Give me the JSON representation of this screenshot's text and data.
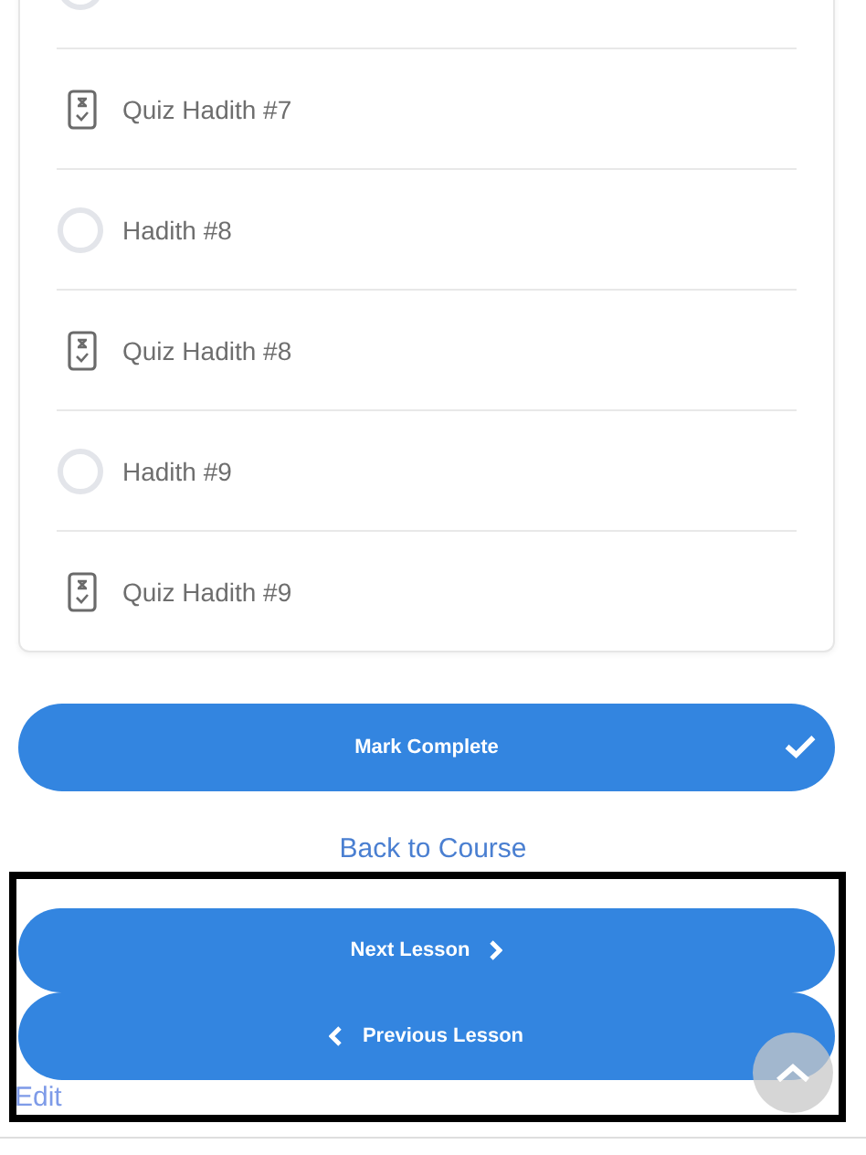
{
  "lessons": [
    {
      "kind": "lesson"
    },
    {
      "kind": "quiz",
      "label": "Quiz Hadith #7"
    },
    {
      "kind": "lesson",
      "label": "Hadith #8"
    },
    {
      "kind": "quiz",
      "label": "Quiz Hadith #8"
    },
    {
      "kind": "lesson",
      "label": "Hadith #9"
    },
    {
      "kind": "quiz",
      "label": "Quiz Hadith #9"
    }
  ],
  "mark_complete": {
    "label": "Mark Complete"
  },
  "back_link": "Back to Course",
  "navigation": {
    "next": "Next Lesson",
    "previous": "Previous Lesson"
  },
  "edit_link": "Edit"
}
